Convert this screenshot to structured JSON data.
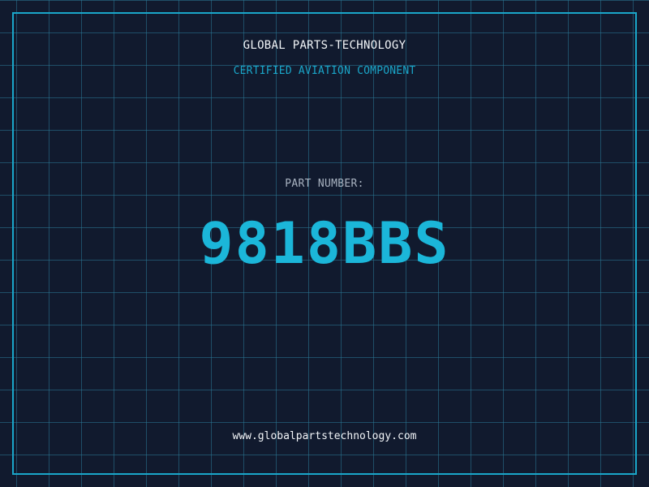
{
  "header": {
    "company_name": "GLOBAL PARTS-TECHNOLOGY",
    "subtitle": "CERTIFIED AVIATION COMPONENT"
  },
  "part": {
    "label": "PART NUMBER:",
    "number": "9818BBS"
  },
  "footer": {
    "website": "www.globalpartstechnology.com"
  },
  "colors": {
    "background": "#111a2e",
    "grid": "#2a7896",
    "accent": "#1bb6d9",
    "frame": "#1aa6c9",
    "text_primary": "#f2f5f8",
    "text_muted": "#a9b3c1"
  }
}
